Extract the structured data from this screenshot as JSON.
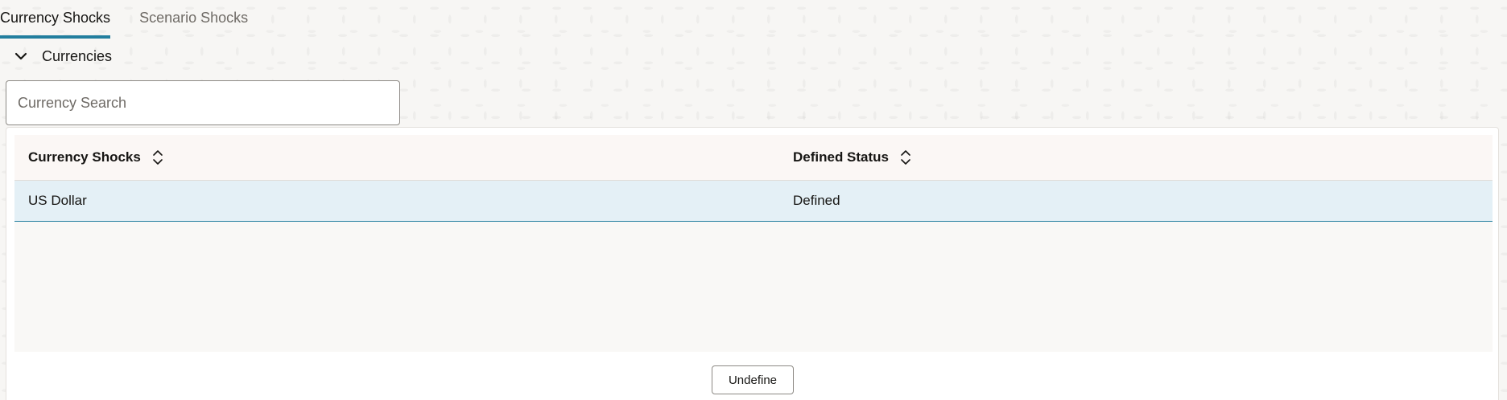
{
  "tabs": [
    {
      "label": "Currency Shocks",
      "active": true
    },
    {
      "label": "Scenario Shocks",
      "active": false
    }
  ],
  "section": {
    "title": "Currencies",
    "expanded": true
  },
  "search": {
    "placeholder": "Currency Search",
    "value": ""
  },
  "table": {
    "columns": [
      {
        "label": "Currency Shocks",
        "sortable": true
      },
      {
        "label": "Defined Status",
        "sortable": true
      }
    ],
    "rows": [
      {
        "currency": "US Dollar",
        "status": "Defined",
        "selected": true
      }
    ]
  },
  "actions": {
    "undefine_label": "Undefine"
  },
  "colors": {
    "accent": "#227e9e",
    "selected_row": "#e4f0f6",
    "header_bg": "#fbf7f5"
  }
}
